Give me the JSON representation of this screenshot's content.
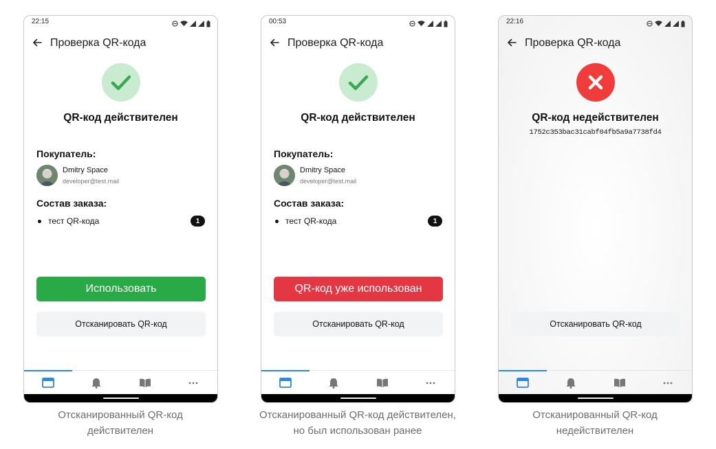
{
  "screens": [
    {
      "time": "22:15",
      "title": "Проверка QR-кода",
      "result": "QR-код действителен",
      "buyer_label": "Покупатель:",
      "buyer_name": "Dmitry Space",
      "buyer_email": "developer@test.mail",
      "order_label": "Состав заказа:",
      "item_name": "тест QR-кода",
      "item_qty": "1",
      "primary_button": "Использовать",
      "scan_button": "Отсканировать QR-код",
      "caption_line1": "Отсканированный QR-код",
      "caption_line2": "действителен"
    },
    {
      "time": "00:53",
      "title": "Проверка QR-кода",
      "result": "QR-код действителен",
      "buyer_label": "Покупатель:",
      "buyer_name": "Dmitry Space",
      "buyer_email": "developer@test.mail",
      "order_label": "Состав заказа:",
      "item_name": "тест QR-кода",
      "item_qty": "1",
      "primary_button": "QR-код уже использован",
      "scan_button": "Отсканировать QR-код",
      "caption_line1": "Отсканированный QR-код действителен,",
      "caption_line2": "но был использован ранее"
    },
    {
      "time": "22:16",
      "title": "Проверка QR-кода",
      "result": "QR-код недействителен",
      "hash": "1752c353bac31cabf04fb5a9a7738fd4",
      "scan_button": "Отсканировать QR-код",
      "caption_line1": "Отсканированный QR-код",
      "caption_line2": "недействителен"
    }
  ],
  "colors": {
    "success_bg": "#c9ebcf",
    "success_check": "#3aa954",
    "error": "#ee3d3a",
    "use_button": "#2aaa47",
    "used_button": "#e43744",
    "tab_active": "#2a86e0"
  },
  "icons": {
    "back": "arrow-left-icon",
    "valid": "check-icon",
    "invalid": "cross-icon",
    "tabs": [
      "window-icon",
      "bell-icon",
      "book-icon",
      "more-icon"
    ]
  }
}
